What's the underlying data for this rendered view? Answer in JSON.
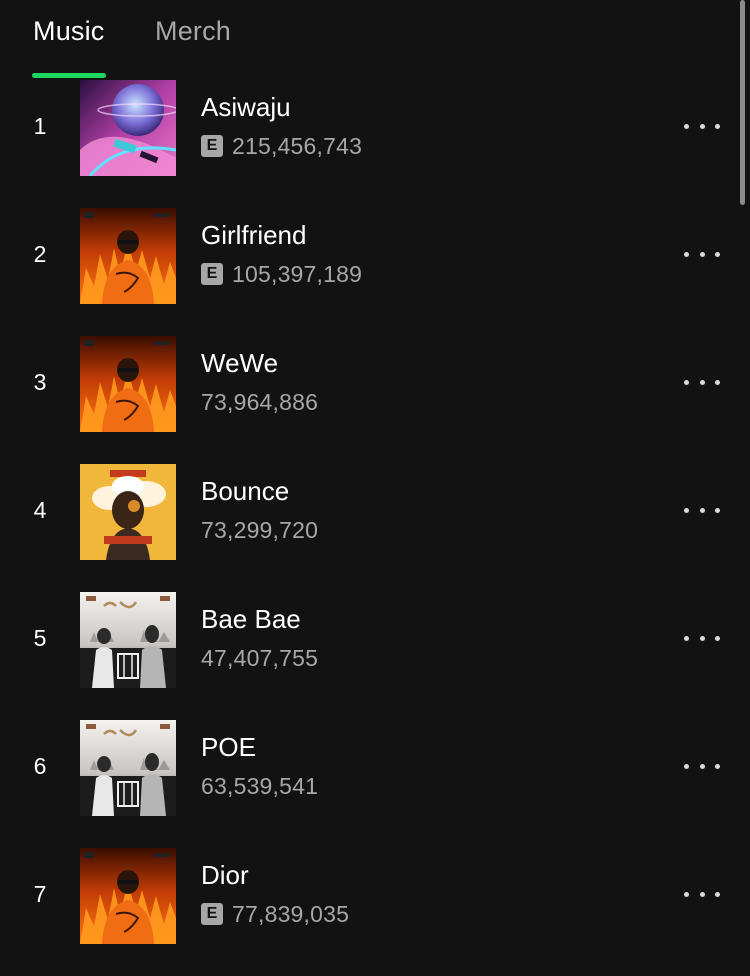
{
  "tabs": {
    "music": "Music",
    "merch": "Merch"
  },
  "colors": {
    "background": "#121212",
    "accent": "#1ed760",
    "primary_text": "#ffffff",
    "secondary_text": "#a7a7a7"
  },
  "explicit_label": "E",
  "more_icon": "more-options-icon",
  "tracks": [
    {
      "rank": "1",
      "title": "Asiwaju",
      "plays": "215,456,743",
      "explicit": true,
      "cover": "asiwaju"
    },
    {
      "rank": "2",
      "title": "Girlfriend",
      "plays": "105,397,189",
      "explicit": true,
      "cover": "fire"
    },
    {
      "rank": "3",
      "title": "WeWe",
      "plays": "73,964,886",
      "explicit": false,
      "cover": "fire"
    },
    {
      "rank": "4",
      "title": "Bounce",
      "plays": "73,299,720",
      "explicit": false,
      "cover": "pandemic"
    },
    {
      "rank": "5",
      "title": "Bae Bae",
      "plays": "47,407,755",
      "explicit": false,
      "cover": "rnb"
    },
    {
      "rank": "6",
      "title": "POE",
      "plays": "63,539,541",
      "explicit": false,
      "cover": "rnb"
    },
    {
      "rank": "7",
      "title": "Dior",
      "plays": "77,839,035",
      "explicit": true,
      "cover": "fire"
    }
  ]
}
